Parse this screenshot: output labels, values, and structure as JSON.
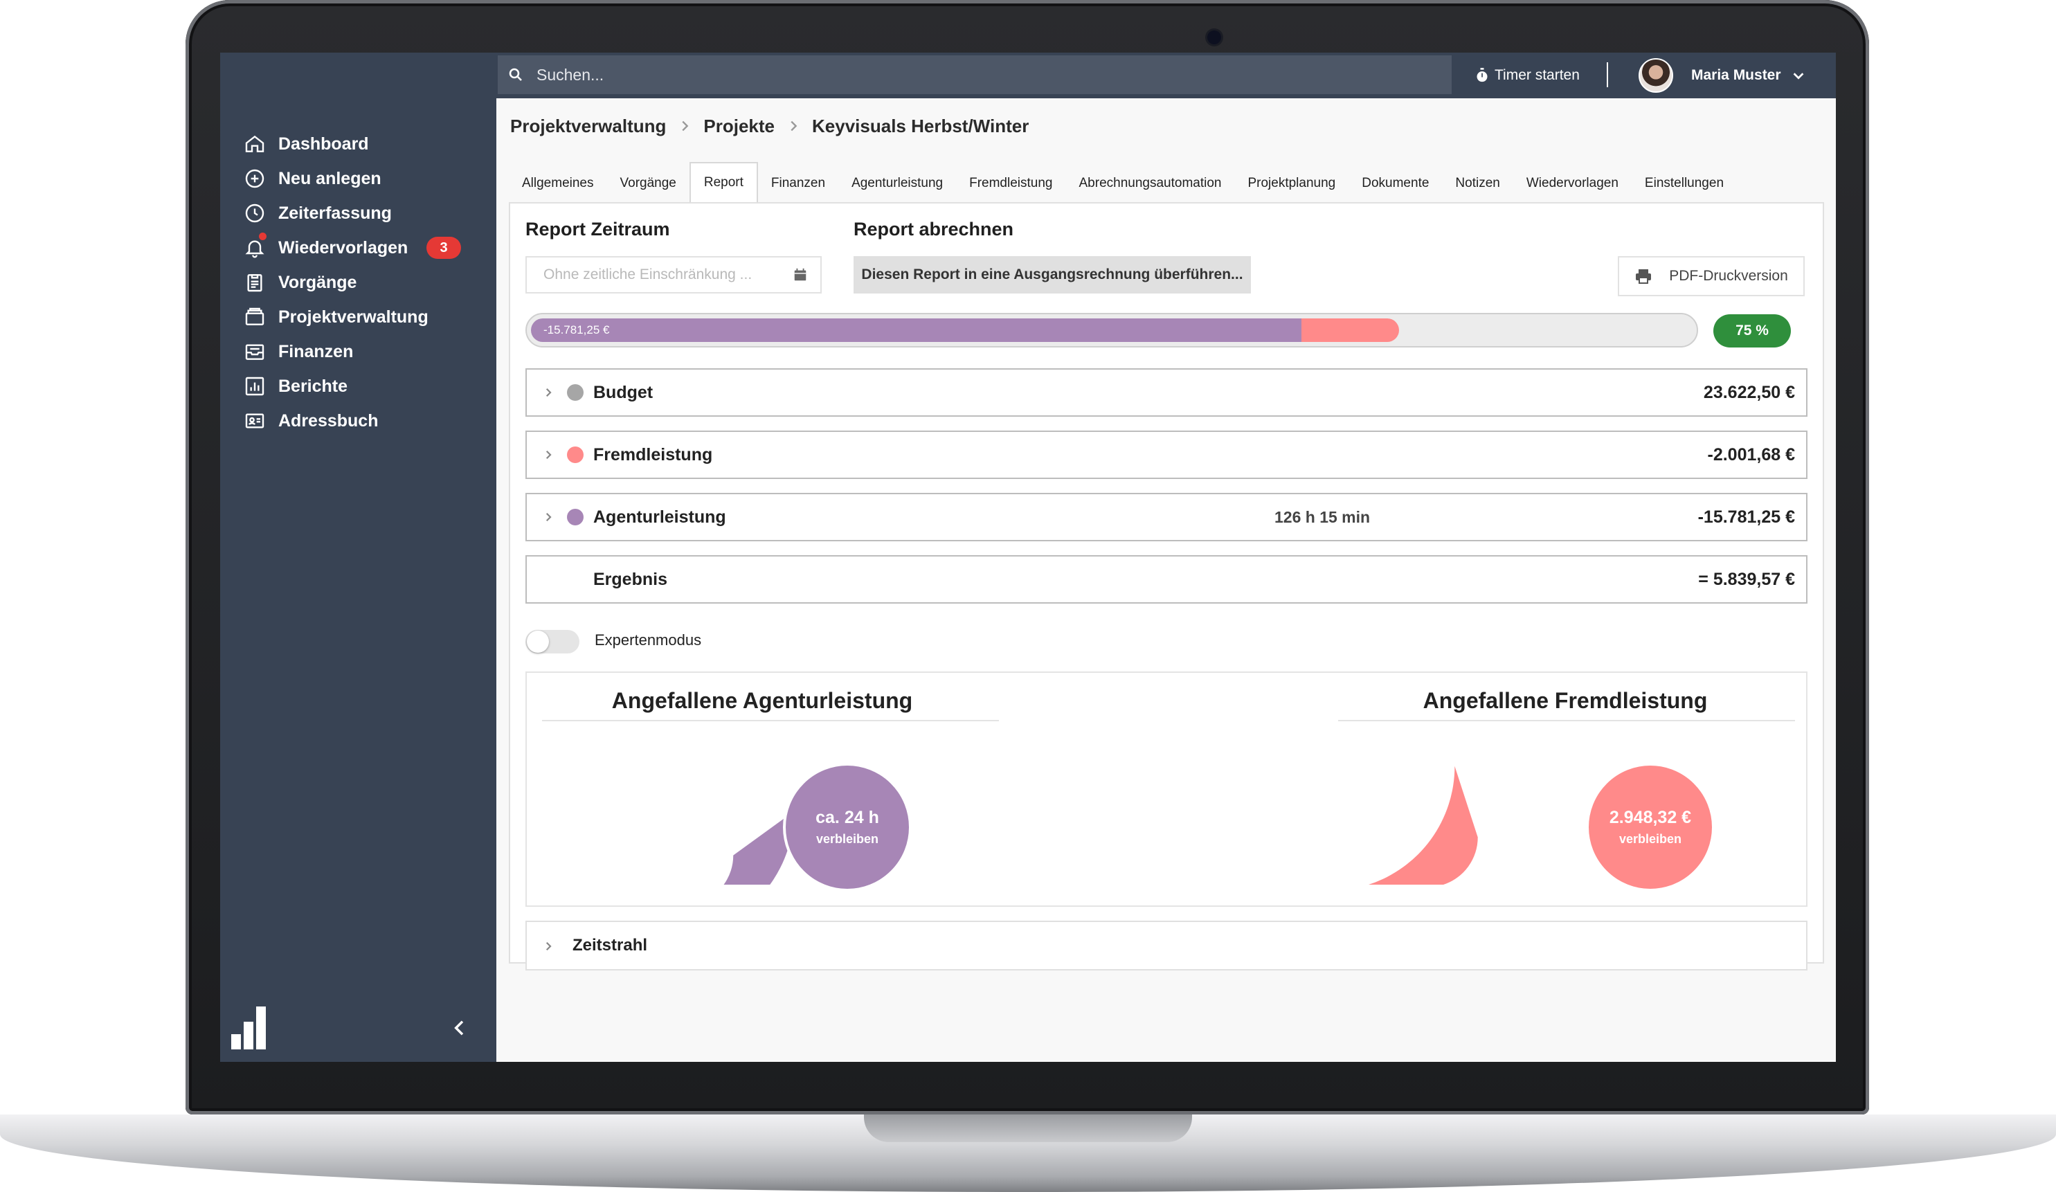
{
  "sidebar": {
    "items": [
      {
        "label": "Dashboard",
        "icon": "home-icon"
      },
      {
        "label": "Neu anlegen",
        "icon": "plus-circle-icon"
      },
      {
        "label": "Zeiterfassung",
        "icon": "clock-icon"
      },
      {
        "label": "Wiedervorlagen",
        "icon": "bell-icon",
        "badge": "3"
      },
      {
        "label": "Vorgänge",
        "icon": "clipboard-icon"
      },
      {
        "label": "Projektverwaltung",
        "icon": "folder-icon"
      },
      {
        "label": "Finanzen",
        "icon": "inbox-icon"
      },
      {
        "label": "Berichte",
        "icon": "chart-icon"
      },
      {
        "label": "Adressbuch",
        "icon": "contact-card-icon"
      }
    ]
  },
  "topbar": {
    "search_placeholder": "Suchen...",
    "timer_label": "Timer starten",
    "user_name": "Maria Muster"
  },
  "breadcrumb": [
    "Projektverwaltung",
    "Projekte",
    "Keyvisuals Herbst/Winter"
  ],
  "tabs": [
    "Allgemeines",
    "Vorgänge",
    "Report",
    "Finanzen",
    "Agenturleistung",
    "Fremdleistung",
    "Abrechnungsautomation",
    "Projektplanung",
    "Dokumente",
    "Notizen",
    "Wiedervorlagen",
    "Einstellungen"
  ],
  "active_tab": "Report",
  "report": {
    "zeitraum_title": "Report Zeitraum",
    "zeitraum_placeholder": "Ohne zeitliche Einschränkung ...",
    "abrechnen_title": "Report abrechnen",
    "abrechnen_button": "Diesen Report in eine Ausgangsrechnung überführen...",
    "pdf_button": "PDF-Druckversion",
    "progress": {
      "label": "-15.781,25 €",
      "agentur_fraction": 0.663,
      "fremd_fraction": 0.084,
      "percent_label": "75 %"
    },
    "rows": [
      {
        "label": "Budget",
        "value": "23.622,50 €",
        "color": "#a6a6a6",
        "mid": ""
      },
      {
        "label": "Fremdleistung",
        "value": "-2.001,68 €",
        "color": "#ff8a8a",
        "mid": ""
      },
      {
        "label": "Agenturleistung",
        "value": "-15.781,25 €",
        "color": "#a786b6",
        "mid": "126 h 15 min"
      },
      {
        "label": "Ergebnis",
        "value": "= 5.839,57 €",
        "color": "",
        "mid": ""
      }
    ],
    "expert_mode_label": "Expertenmodus",
    "expert_mode_on": false
  },
  "charts": {
    "agentur": {
      "title": "Angefallene Agenturleistung",
      "used_fraction": 0.8,
      "bubble_big": "ca. 24 h",
      "bubble_small": "verbleiben",
      "color": "#a786b6"
    },
    "fremd": {
      "title": "Angefallene Fremdleistung",
      "used_fraction": 0.4,
      "bubble_big": "2.948,32 €",
      "bubble_small": "verbleiben",
      "color": "#ff8a8a"
    }
  },
  "zeitstrahl_label": "Zeitstrahl",
  "colors": {
    "sidebar": "#384354",
    "accent_green": "#2f8f3c",
    "badge_red": "#e53935"
  }
}
